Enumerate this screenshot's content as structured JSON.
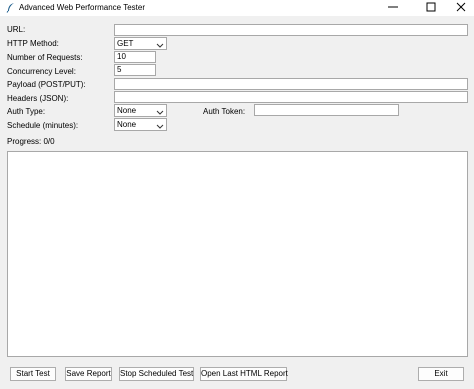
{
  "window": {
    "title": "Advanced Web Performance Tester"
  },
  "form": {
    "url": {
      "label": "URL:",
      "value": ""
    },
    "http_method": {
      "label": "HTTP Method:",
      "value": "GET"
    },
    "num_requests": {
      "label": "Number of Requests:",
      "value": "10"
    },
    "concurrency": {
      "label": "Concurrency Level:",
      "value": "5"
    },
    "payload": {
      "label": "Payload (POST/PUT):",
      "value": ""
    },
    "headers": {
      "label": "Headers (JSON):",
      "value": ""
    },
    "auth_type": {
      "label": "Auth Type:",
      "value": "None"
    },
    "auth_token": {
      "label": "Auth Token:",
      "value": ""
    },
    "schedule": {
      "label": "Schedule (minutes):",
      "value": "None"
    }
  },
  "progress": {
    "text": "Progress: 0/0"
  },
  "output": {
    "text": ""
  },
  "buttons": {
    "start": "Start Test",
    "save": "Save Report",
    "stop_scheduled": "Stop Scheduled Test",
    "open_report": "Open Last HTML Report",
    "exit": "Exit"
  },
  "icons": {
    "app": "feather-icon",
    "minimize": "minimize-icon",
    "maximize": "maximize-icon",
    "close": "close-icon",
    "dropdown": "chevron-down-icon"
  }
}
